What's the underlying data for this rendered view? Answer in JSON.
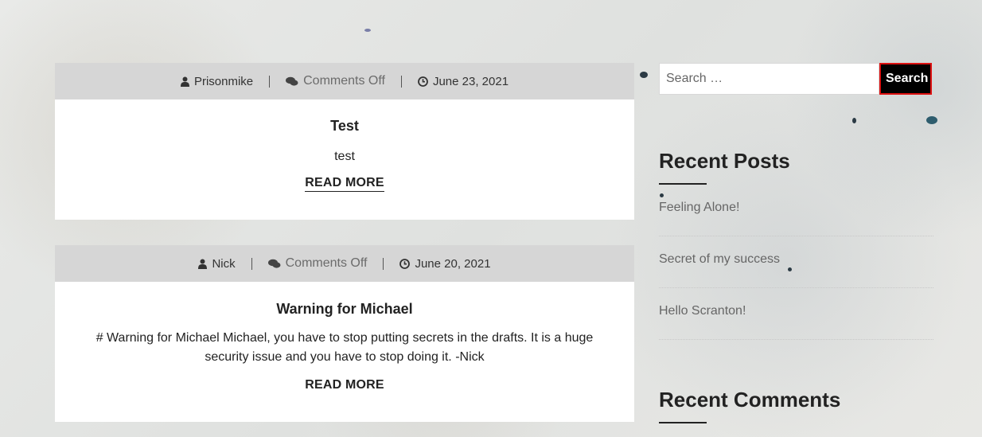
{
  "posts": [
    {
      "author": "Prisonmike",
      "comments": "Comments Off",
      "date": "June 23, 2021",
      "title": "Test",
      "excerpt": "test",
      "read_more": "READ MORE"
    },
    {
      "author": "Nick",
      "comments": "Comments Off",
      "date": "June 20, 2021",
      "title": "Warning for Michael",
      "excerpt": "# Warning for Michael Michael, you have to stop putting secrets in the drafts. It is a huge security issue and you have to stop doing it. -Nick",
      "read_more": "READ MORE"
    }
  ],
  "sidebar": {
    "search": {
      "placeholder": "Search …",
      "button_label": "Search"
    },
    "recent_posts": {
      "title": "Recent Posts",
      "items": [
        "Feeling Alone!",
        "Secret of my success",
        "Hello Scranton!"
      ]
    },
    "recent_comments": {
      "title": "Recent Comments"
    }
  },
  "colors": {
    "meta_bar": "#d6d6d6",
    "search_button": "#000000",
    "search_button_border": "#dd1111"
  }
}
